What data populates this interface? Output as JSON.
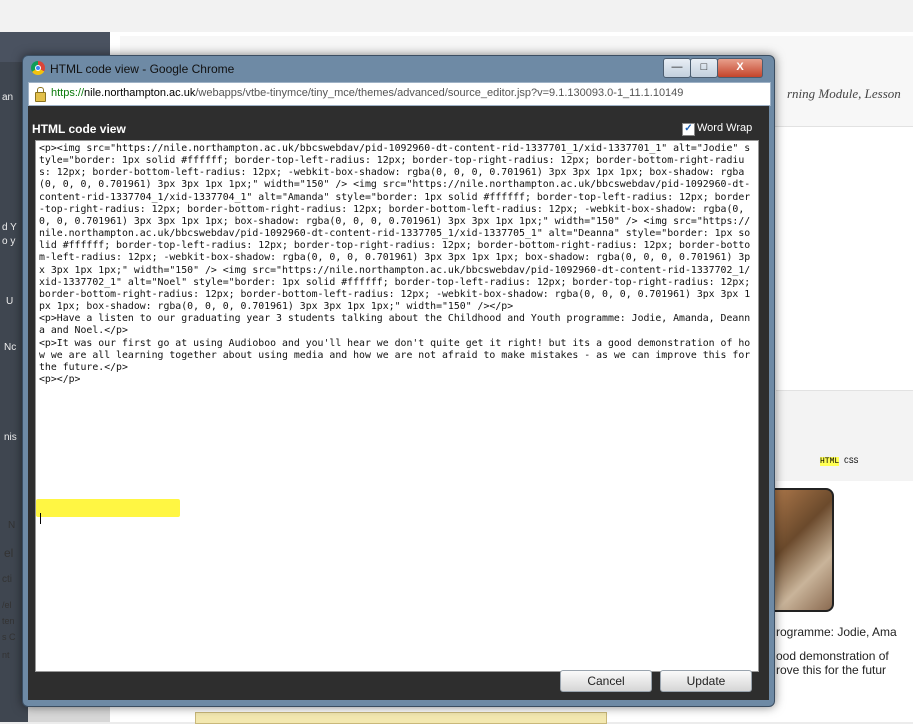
{
  "background": {
    "lesson_title": "rning Module, Lesson",
    "html_button": "HTML",
    "css_button": "CSS",
    "preview_line1": "rogramme: Jodie, Ama",
    "preview_line2": "ood demonstration of",
    "preview_line3": "rove this for the futur",
    "side_fragments": [
      "an",
      "d Y",
      "o y",
      "U",
      "Nc",
      "nis",
      "N",
      "el",
      "cti",
      "/el",
      "ten",
      "s C",
      "nt"
    ]
  },
  "window": {
    "title": "HTML code view - Google Chrome",
    "url_scheme": "https://",
    "url_host": "nile.northampton.ac.uk",
    "url_path": "/webapps/vtbe-tinymce/tiny_mce/themes/advanced/source_editor.jsp?v=9.1.130093.0-1_11.1.10149",
    "controls": {
      "minimize": "—",
      "maximize": "□",
      "close": "X"
    }
  },
  "dialog": {
    "heading": "HTML code view",
    "word_wrap_label": "Word Wrap",
    "word_wrap_checked": true,
    "code": "<p><img src=\"https://nile.northampton.ac.uk/bbcswebdav/pid-1092960-dt-content-rid-1337701_1/xid-1337701_1\" alt=\"Jodie\" style=\"border: 1px solid #ffffff; border-top-left-radius: 12px; border-top-right-radius: 12px; border-bottom-right-radius: 12px; border-bottom-left-radius: 12px; -webkit-box-shadow: rgba(0, 0, 0, 0.701961) 3px 3px 1px 1px; box-shadow: rgba(0, 0, 0, 0.701961) 3px 3px 1px 1px;\" width=\"150\" /> <img src=\"https://nile.northampton.ac.uk/bbcswebdav/pid-1092960-dt-content-rid-1337704_1/xid-1337704_1\" alt=\"Amanda\" style=\"border: 1px solid #ffffff; border-top-left-radius: 12px; border-top-right-radius: 12px; border-bottom-right-radius: 12px; border-bottom-left-radius: 12px; -webkit-box-shadow: rgba(0, 0, 0, 0.701961) 3px 3px 1px 1px; box-shadow: rgba(0, 0, 0, 0.701961) 3px 3px 1px 1px;\" width=\"150\" /> <img src=\"https://nile.northampton.ac.uk/bbcswebdav/pid-1092960-dt-content-rid-1337705_1/xid-1337705_1\" alt=\"Deanna\" style=\"border: 1px solid #ffffff; border-top-left-radius: 12px; border-top-right-radius: 12px; border-bottom-right-radius: 12px; border-bottom-left-radius: 12px; -webkit-box-shadow: rgba(0, 0, 0, 0.701961) 3px 3px 1px 1px; box-shadow: rgba(0, 0, 0, 0.701961) 3px 3px 1px 1px;\" width=\"150\" /> <img src=\"https://nile.northampton.ac.uk/bbcswebdav/pid-1092960-dt-content-rid-1337702_1/xid-1337702_1\" alt=\"Noel\" style=\"border: 1px solid #ffffff; border-top-left-radius: 12px; border-top-right-radius: 12px; border-bottom-right-radius: 12px; border-bottom-left-radius: 12px; -webkit-box-shadow: rgba(0, 0, 0, 0.701961) 3px 3px 1px 1px; box-shadow: rgba(0, 0, 0, 0.701961) 3px 3px 1px 1px;\" width=\"150\" /></p>\n<p>Have a listen to our graduating year 3 students talking about the Childhood and Youth programme: Jodie, Amanda, Deanna and Noel.</p>\n<p>It was our first go at using Audioboo and you'll hear we don't quite get it right! but its a good demonstration of how we are all learning together about using media and how we are not afraid to make mistakes - as we can improve this for the future.</p>\n<p></p>",
    "cancel_label": "Cancel",
    "update_label": "Update"
  },
  "colors": {
    "highlight": "#fff52f",
    "dialog_bg": "#2e2e2e",
    "window_frame": "#6e8aa5"
  }
}
